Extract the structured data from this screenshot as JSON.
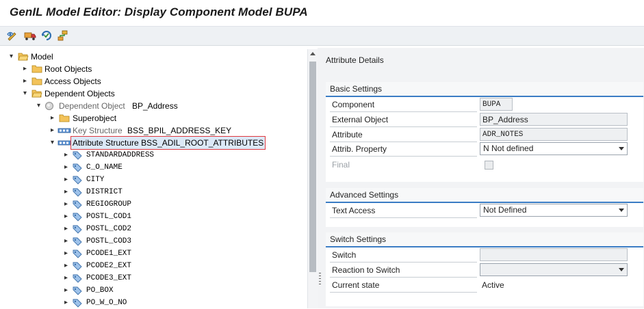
{
  "window": {
    "title": "GenIL Model Editor: Display Component Model BUPA"
  },
  "toolbar": {
    "buttons": [
      {
        "icon": "display-change-toggle-icon"
      },
      {
        "icon": "transport-icon"
      },
      {
        "icon": "check-object-icon"
      },
      {
        "icon": "hierarchy-icon"
      }
    ]
  },
  "tree": {
    "root": "Model",
    "root_objects": "Root Objects",
    "access_objects": "Access Objects",
    "dependent_objects": "Dependent Objects",
    "dep_object_prefix": "Dependent Object",
    "dep_object_name": "BP_Address",
    "superobject": "Superobject",
    "key_structure_prefix": "Key Structure",
    "key_structure_name": "BSS_BPIL_ADDRESS_KEY",
    "attr_structure_prefix": "Attribute Structure",
    "attr_structure_name": "BSS_ADIL_ROOT_ATTRIBUTES",
    "attributes": [
      "STANDARDADDRESS",
      "C_O_NAME",
      "CITY",
      "DISTRICT",
      "REGIOGROUP",
      "POSTL_COD1",
      "POSTL_COD2",
      "POSTL_COD3",
      "PCODE1_EXT",
      "PCODE2_EXT",
      "PCODE3_EXT",
      "PO_BOX",
      "PO_W_O_NO"
    ]
  },
  "details": {
    "title": "Attribute Details",
    "basic": {
      "header": "Basic Settings",
      "component_label": "Component",
      "component_value": "BUPA",
      "external_object_label": "External Object",
      "external_object_value": "BP_Address",
      "attribute_label": "Attribute",
      "attribute_value": "ADR_NOTES",
      "attrib_property_label": "Attrib. Property",
      "attrib_property_value": "N Not defined",
      "final_label": "Final",
      "final_checked": false
    },
    "advanced": {
      "header": "Advanced Settings",
      "text_access_label": "Text Access",
      "text_access_value": "Not Defined"
    },
    "switch": {
      "header": "Switch Settings",
      "switch_label": "Switch",
      "switch_value": "",
      "reaction_label": "Reaction to Switch",
      "reaction_value": "",
      "current_state_label": "Current state",
      "current_state_value": "Active"
    }
  }
}
